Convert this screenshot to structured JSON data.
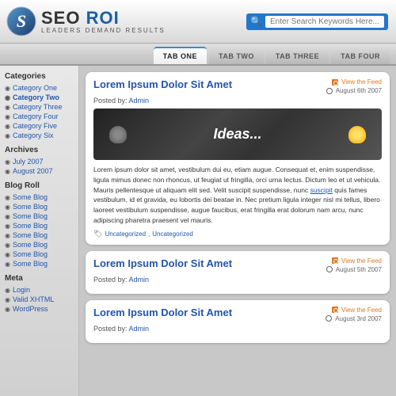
{
  "header": {
    "logo_text": "SEO",
    "logo_roi": "ROI",
    "tagline": "Leaders  Demand  Results",
    "search_placeholder": "Enter Search Keywords Here..."
  },
  "tabs": [
    {
      "label": "Tab One",
      "id": "tab-one",
      "active": true
    },
    {
      "label": "Tab Two",
      "id": "tab-two",
      "active": false
    },
    {
      "label": "Tab Three",
      "id": "tab-three",
      "active": false
    },
    {
      "label": "Tab Four",
      "id": "tab-four",
      "active": false
    }
  ],
  "sidebar": {
    "sections": [
      {
        "title": "Categories",
        "items": [
          "Category One",
          "Category Two",
          "Category Three",
          "Category Four",
          "Category Five",
          "Category Six"
        ]
      },
      {
        "title": "Archives",
        "items": [
          "July 2007",
          "August 2007"
        ]
      },
      {
        "title": "Blog Roll",
        "items": [
          "Some Blog",
          "Some Blog",
          "Some Blog",
          "Some Blog",
          "Some Blog",
          "Some Blog",
          "Some Blog",
          "Some Blog"
        ]
      },
      {
        "title": "Meta",
        "items": [
          "Login",
          "Valid XHTML",
          "WordPress"
        ]
      }
    ]
  },
  "posts": [
    {
      "id": "post-1",
      "title": "Lorem Ipsum Dolor Sit Amet",
      "byline": "Posted by: Admin",
      "view_feed": "View the Feed",
      "date": "August 6th 2007",
      "has_image": true,
      "image_text": "Ideas...",
      "body": "Lorem ipsum dolor sit amet, vestibulum dui eu, etiam augue. Consequat et, enim suspendisse, ligula mimus donec non rhoncus, ut feugiat ut fringilla, orci urna lectus. Dictum leo et ut vehicula. Mauris pellentesque ut aliquam elit sed. Velit suscipit suspendisse, nunc suscipit quis fames vestibulum, id et gravida, eu lobortis dei beatae in. Nec pretium ligula integer nisl mi tellus, libero laoreet vestibulum suspendisse, augue faucibus, erat fringilla erat dolorum nam arcu, nunc adipiscing pharetra praesent vel mauris.",
      "link_word": "suscipit",
      "tags": [
        "Uncategorized",
        "Uncategorized"
      ]
    },
    {
      "id": "post-2",
      "title": "Lorem Ipsum Dolor Sit Amet",
      "byline": "Posted by: Admin",
      "view_feed": "View the Feed",
      "date": "August 5th 2007",
      "has_image": false,
      "body": "",
      "tags": []
    },
    {
      "id": "post-3",
      "title": "Lorem Ipsum Dolor Sit Amet",
      "byline": "Posted by: Admin",
      "view_feed": "View the Feed",
      "date": "August 3rd 2007",
      "has_image": false,
      "body": "",
      "tags": []
    }
  ],
  "colors": {
    "accent_blue": "#2255aa",
    "accent_orange": "#e07820",
    "tab_active_border": "#4488cc"
  }
}
